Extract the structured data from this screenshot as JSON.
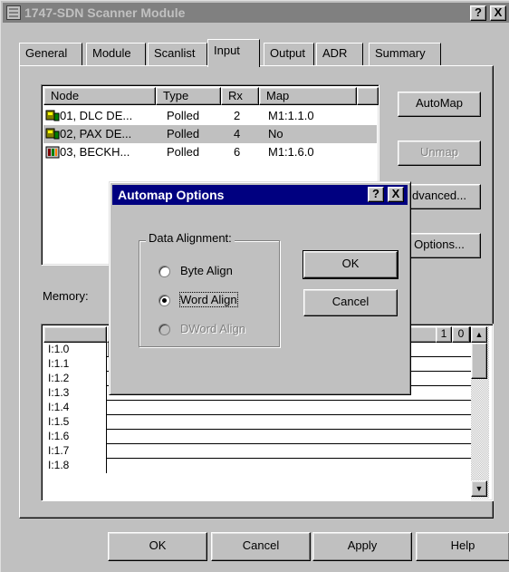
{
  "window": {
    "title": "1747-SDN Scanner Module",
    "help_btn": "?",
    "close_btn": "X"
  },
  "tabs": [
    "General",
    "Module",
    "Scanlist",
    "Input",
    "Output",
    "ADR",
    "Summary"
  ],
  "active_tab": "Input",
  "list": {
    "columns": [
      "Node",
      "Type",
      "Rx",
      "Map"
    ],
    "rows": [
      {
        "node": "01, DLC DE...",
        "type": "Polled",
        "rx": "2",
        "map": "M1:1.1.0",
        "icon": "device-icon",
        "selected": false
      },
      {
        "node": "02, PAX DE...",
        "type": "Polled",
        "rx": "4",
        "map": "No",
        "icon": "device-icon",
        "selected": true
      },
      {
        "node": "03, BECKH...",
        "type": "Polled",
        "rx": "6",
        "map": "M1:1.6.0",
        "icon": "rack-device-icon",
        "selected": false
      }
    ]
  },
  "side_buttons": {
    "automap": "AutoMap",
    "unmap": "Unmap",
    "advanced": "dvanced...",
    "options": "Options..."
  },
  "memory": {
    "label": "Memory:",
    "header_left": "1",
    "header_right": [
      "1",
      "0"
    ],
    "rows": [
      "I:1.0",
      "I:1.1",
      "I:1.2",
      "I:1.3",
      "I:1.4",
      "I:1.5",
      "I:1.6",
      "I:1.7",
      "I:1.8"
    ]
  },
  "dialog": {
    "title": "Automap Options",
    "help_btn": "?",
    "close_btn": "X",
    "group_label": "Data Alignment:",
    "options": [
      {
        "label": "Byte Align",
        "checked": false,
        "disabled": false
      },
      {
        "label": "Word Align",
        "checked": true,
        "disabled": false
      },
      {
        "label": "DWord Align",
        "checked": false,
        "disabled": true
      }
    ],
    "ok": "OK",
    "cancel": "Cancel"
  },
  "footer": {
    "ok": "OK",
    "cancel": "Cancel",
    "apply": "Apply",
    "help": "Help"
  }
}
